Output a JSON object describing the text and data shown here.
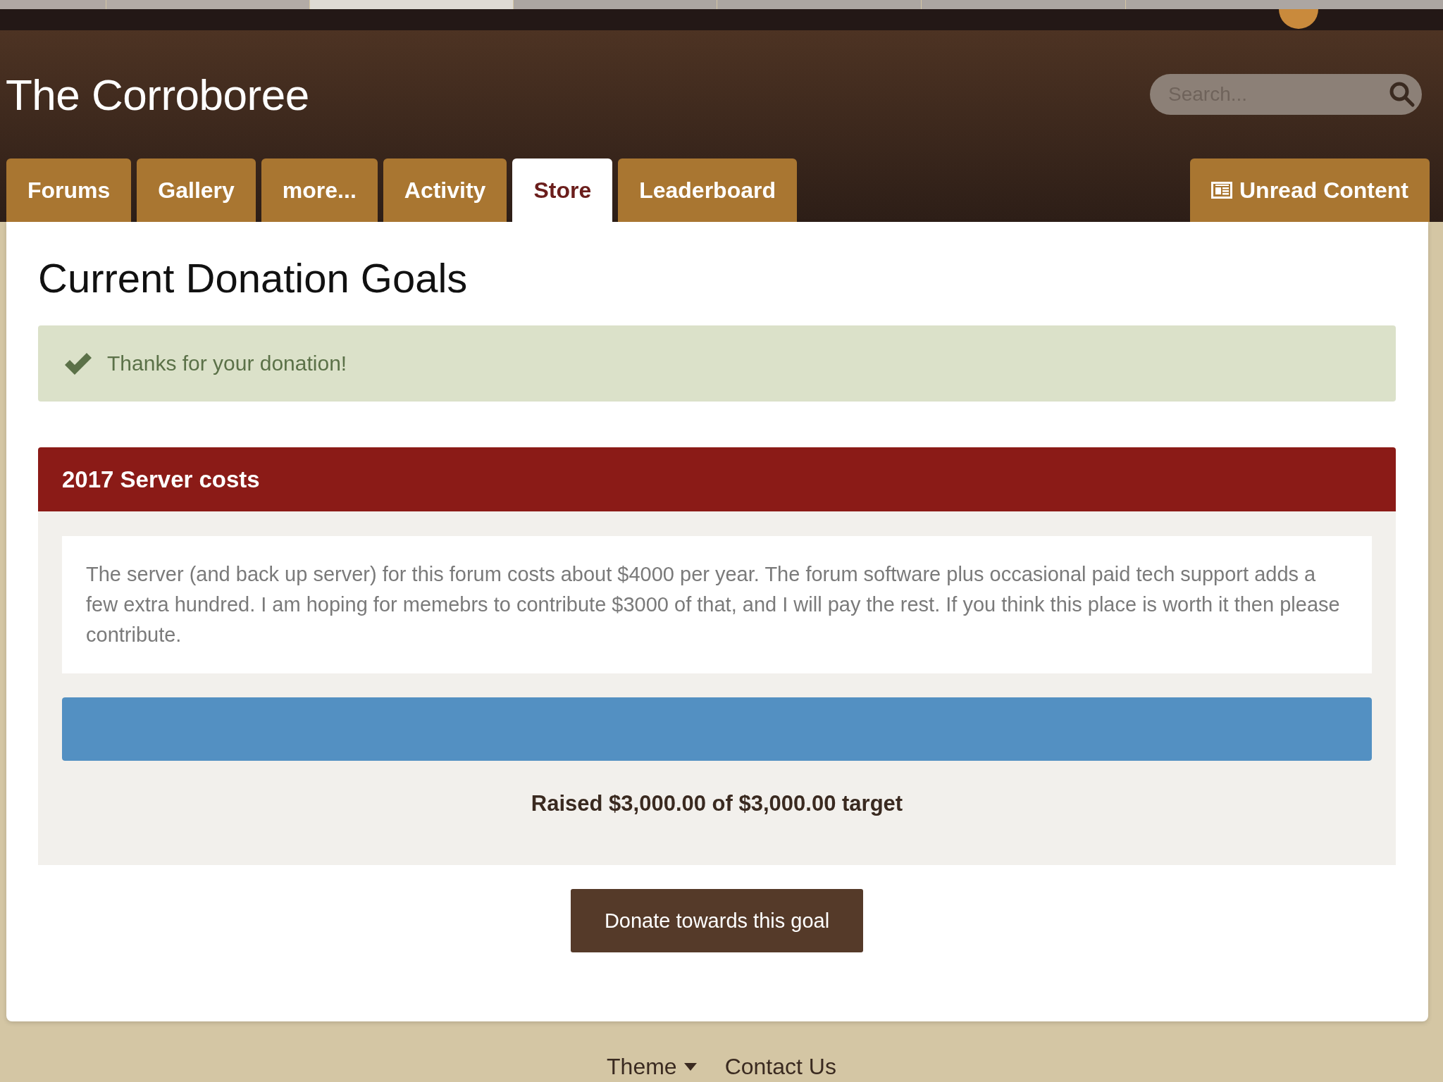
{
  "site": {
    "title": "The Corroboree",
    "search": {
      "placeholder": "Search..."
    }
  },
  "tabs": [
    {
      "label": "Forums",
      "selected": false
    },
    {
      "label": "Gallery",
      "selected": false
    },
    {
      "label": "more...",
      "selected": false
    },
    {
      "label": "Activity",
      "selected": false
    },
    {
      "label": "Store",
      "selected": true
    },
    {
      "label": "Leaderboard",
      "selected": false
    }
  ],
  "unread_button": {
    "label": "Unread Content"
  },
  "page": {
    "heading": "Current Donation Goals",
    "notice": "Thanks for your donation!"
  },
  "goal": {
    "title": "2017 Server costs",
    "description": "The server (and back up server) for this forum costs about $4000 per year. The forum software plus occasional paid tech support adds a few extra hundred. I am hoping for memebrs to contribute $3000 of that, and I will pay the rest. If you think this place is worth it then please contribute.",
    "progress": {
      "level": 1
    },
    "raised": "Raised $3,000.00 of $3,000.00 target",
    "button": "Donate towards this goal"
  },
  "footer": {
    "links": [
      {
        "label": "Theme",
        "kind": "dropdown"
      },
      {
        "label": "Contact Us",
        "kind": "link"
      }
    ]
  }
}
